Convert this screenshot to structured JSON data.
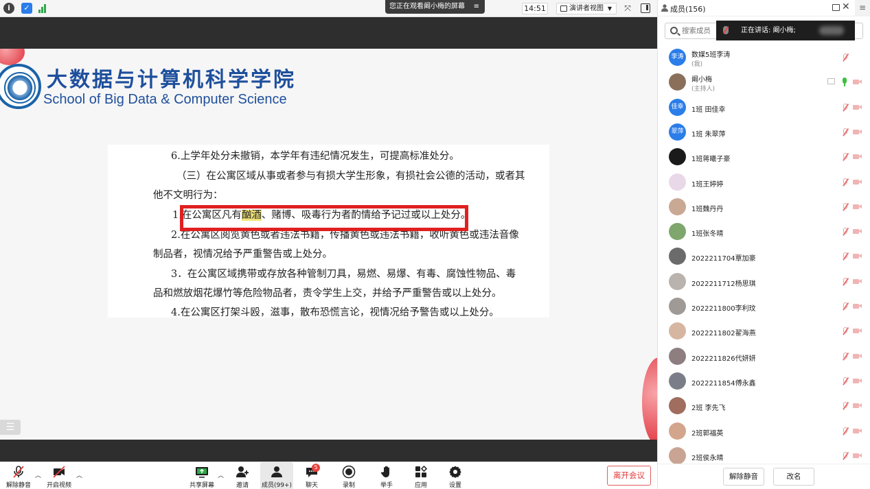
{
  "top_bar": {
    "watching_banner": "您正在观看阚小梅的屏幕",
    "clock": "14:51",
    "view_label": "演讲者视图"
  },
  "slide": {
    "school_cn": "大数据与计算机科学学院",
    "school_en": "School of Big Data & Computer Science",
    "lines": [
      "6.上学年处分未撤销，本学年有违纪情况发生，可提高标准处分。",
      "（三）在公寓区域从事或者参与有损大学生形象，有损社会公德的活动，或者其",
      "他不文明行为：",
      "1.",
      "在公寓区凡有",
      "酗酒",
      "、赌博、吸毒行为者酌情给予记过或以上处分。",
      "2.在公寓区阅览黄色或者违法书籍，传播黄色或违法书籍，收听黄色或违法音像",
      "制品者，视情况给予严重警告或上处分。",
      "3．在公寓区域携带或存放各种管制刀具，易燃、易爆、有毒、腐蚀性物品、毒",
      "品和燃放烟花爆竹等危险物品者，责令学生上交，并给予严重警告或以上处分。",
      "4.在公寓区打架斗殴，滋事，散布恐慌言论，视情况给予警告或以上处分。"
    ]
  },
  "toolbar": {
    "unmute": "解除静音",
    "start_video": "开启视频",
    "share_screen": "共享屏幕",
    "invite": "邀请",
    "members": "成员(99+)",
    "chat": "聊天",
    "chat_badge": "5",
    "record": "录制",
    "raise_hand": "举手",
    "apps": "应用",
    "settings": "设置",
    "leave": "离开会议"
  },
  "panel": {
    "title": "成员(156)",
    "search_placeholder": "搜索成员",
    "speaking": "正在讲话: 阚小梅;",
    "members": [
      {
        "name": "数媒5班李涛",
        "role": "(我)",
        "avatar_text": "李涛",
        "avatar_color": "#2b7de9"
      },
      {
        "name": "阚小梅",
        "role": "(主持人)",
        "avatar_text": "",
        "avatar_color": "#8a6f5a"
      },
      {
        "name": "1班 田佳幸",
        "role": "",
        "avatar_text": "佳幸",
        "avatar_color": "#2b7de9"
      },
      {
        "name": "1班 朱翠萍",
        "role": "",
        "avatar_text": "翠萍",
        "avatar_color": "#2b7de9"
      },
      {
        "name": "1班蒋曦子豪",
        "role": "",
        "avatar_text": "",
        "avatar_color": "#1a1a1a"
      },
      {
        "name": "1班王婷婷",
        "role": "",
        "avatar_text": "",
        "avatar_color": "#e9d8e8"
      },
      {
        "name": "1班魏丹丹",
        "role": "",
        "avatar_text": "",
        "avatar_color": "#c9a894"
      },
      {
        "name": "1班张冬晴",
        "role": "",
        "avatar_text": "",
        "avatar_color": "#7fa66c"
      },
      {
        "name": "2022211704覃加豪",
        "role": "",
        "avatar_text": "",
        "avatar_color": "#6b6b6b"
      },
      {
        "name": "2022211712杨思琪",
        "role": "",
        "avatar_text": "",
        "avatar_color": "#b9b2ad"
      },
      {
        "name": "2022211800李利玟",
        "role": "",
        "avatar_text": "",
        "avatar_color": "#9f9a96"
      },
      {
        "name": "2022211802翟海燕",
        "role": "",
        "avatar_text": "",
        "avatar_color": "#d7b6a1"
      },
      {
        "name": "2022211826代妍妍",
        "role": "",
        "avatar_text": "",
        "avatar_color": "#8e7e80"
      },
      {
        "name": "2022211854傅永鑫",
        "role": "",
        "avatar_text": "",
        "avatar_color": "#7b7e88"
      },
      {
        "name": "2班 李先飞",
        "role": "",
        "avatar_text": "",
        "avatar_color": "#a06d5f"
      },
      {
        "name": "2班郭福英",
        "role": "",
        "avatar_text": "",
        "avatar_color": "#d3a58c"
      },
      {
        "name": "2班侯永晴",
        "role": "",
        "avatar_text": "",
        "avatar_color": "#c9a493"
      }
    ],
    "unmute_all": "解除静音",
    "rename": "改名"
  }
}
